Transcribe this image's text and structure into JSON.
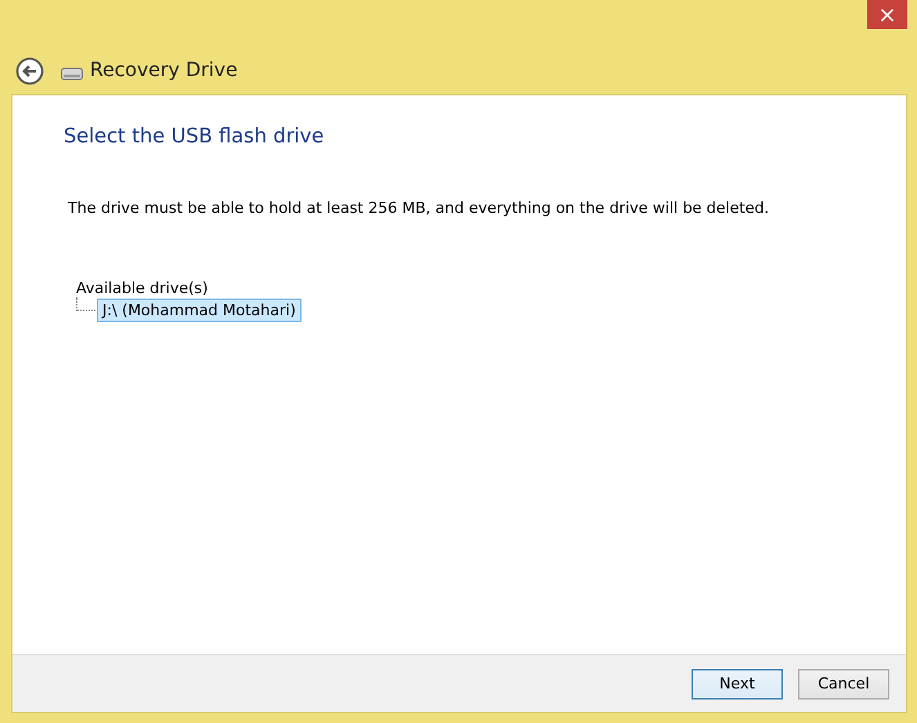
{
  "window": {
    "close": "×"
  },
  "header": {
    "title": "Recovery Drive"
  },
  "page": {
    "heading": "Select the USB flash drive",
    "description": "The drive must be able to hold at least 256 MB, and everything on the drive will be deleted.",
    "tree": {
      "label": "Available drive(s)",
      "items": [
        {
          "label": "J:\\ (Mohammad Motahari)",
          "selected": true
        }
      ]
    }
  },
  "buttons": [
    {
      "label": "Next",
      "kind": "default"
    },
    {
      "label": "Cancel",
      "kind": "normal"
    }
  ]
}
